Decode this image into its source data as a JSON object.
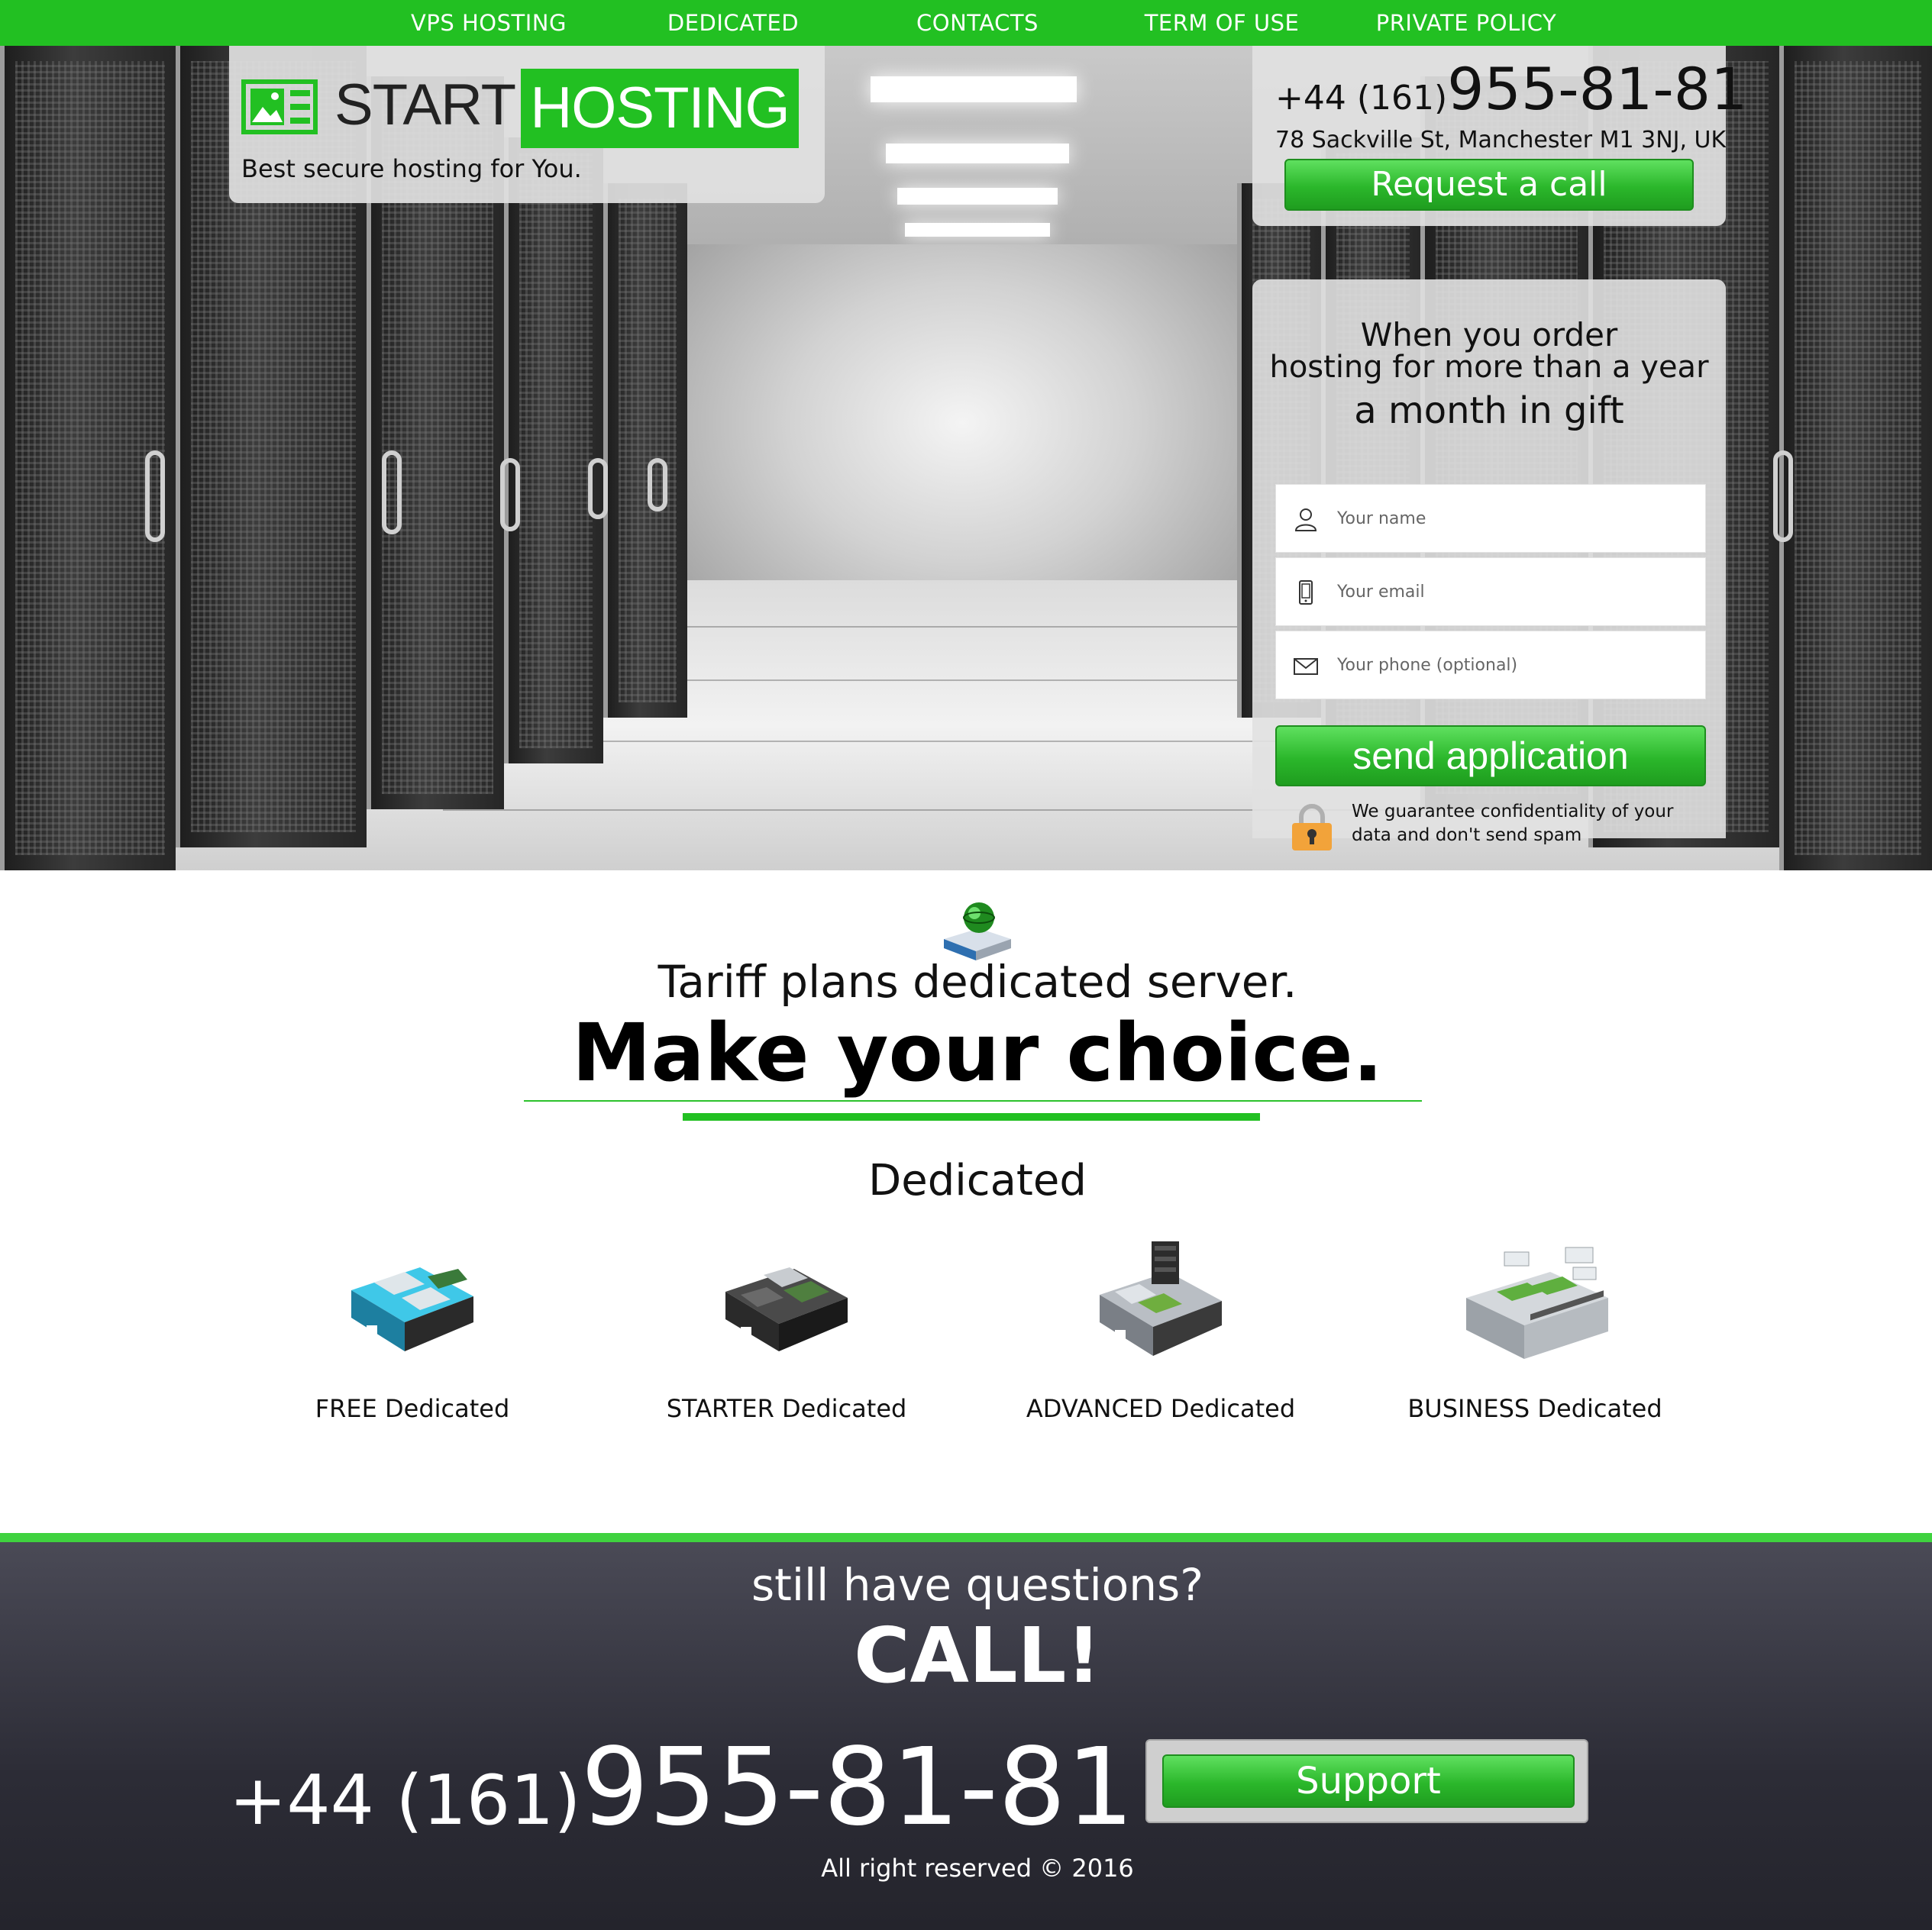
{
  "nav": {
    "items": [
      {
        "label": "VPS HOSTING"
      },
      {
        "label": "DEDICATED"
      },
      {
        "label": "CONTACTS"
      },
      {
        "label": "TERM OF USE"
      },
      {
        "label": "PRIVATE POLICY"
      }
    ]
  },
  "logo": {
    "start": "START",
    "hosting": "HOSTING",
    "tagline": "Best secure hosting for You.",
    "icon": "image-card-icon"
  },
  "contact": {
    "phone_prefix": "+44 (161)",
    "phone_number": "955-81-81",
    "address": "78 Sackville St, Manchester M1 3NJ, UK",
    "request_button": "Request a call"
  },
  "offer": {
    "line1": "When you order",
    "line2": "hosting for more than a year",
    "line3": "a month in gift"
  },
  "form": {
    "name_placeholder": "Your name",
    "email_placeholder": "Your email",
    "phone_placeholder": "Your phone (optional)",
    "name_value": "",
    "email_value": "",
    "phone_value": "",
    "submit_label": "send application",
    "guarantee": "We guarantee confidentiality of your data and don't send spam",
    "icons": [
      "user-icon",
      "phone-device-icon",
      "envelope-icon",
      "lock-icon"
    ]
  },
  "tariffs": {
    "subtitle": "Tariff plans dedicated server.",
    "title": "Make your choice.",
    "section": "Dedicated",
    "plans": [
      {
        "label": "FREE Dedicated",
        "icon": "server-blade-blue-icon"
      },
      {
        "label": "STARTER Dedicated",
        "icon": "server-blade-dark-icon"
      },
      {
        "label": "ADVANCED Dedicated",
        "icon": "server-blade-sata-icon"
      },
      {
        "label": "BUSINESS Dedicated",
        "icon": "server-rack-unit-icon"
      }
    ]
  },
  "footer": {
    "question": "still have questions?",
    "call": "CALL!",
    "phone_prefix": "+44 (161)",
    "phone_number": "955-81-81",
    "support_button": "Support",
    "copyright": "All right reserved © 2016"
  },
  "colors": {
    "brand_green": "#22c022",
    "footer_dark": "#2c2c36",
    "panel_gray": "#e1e1e1"
  }
}
